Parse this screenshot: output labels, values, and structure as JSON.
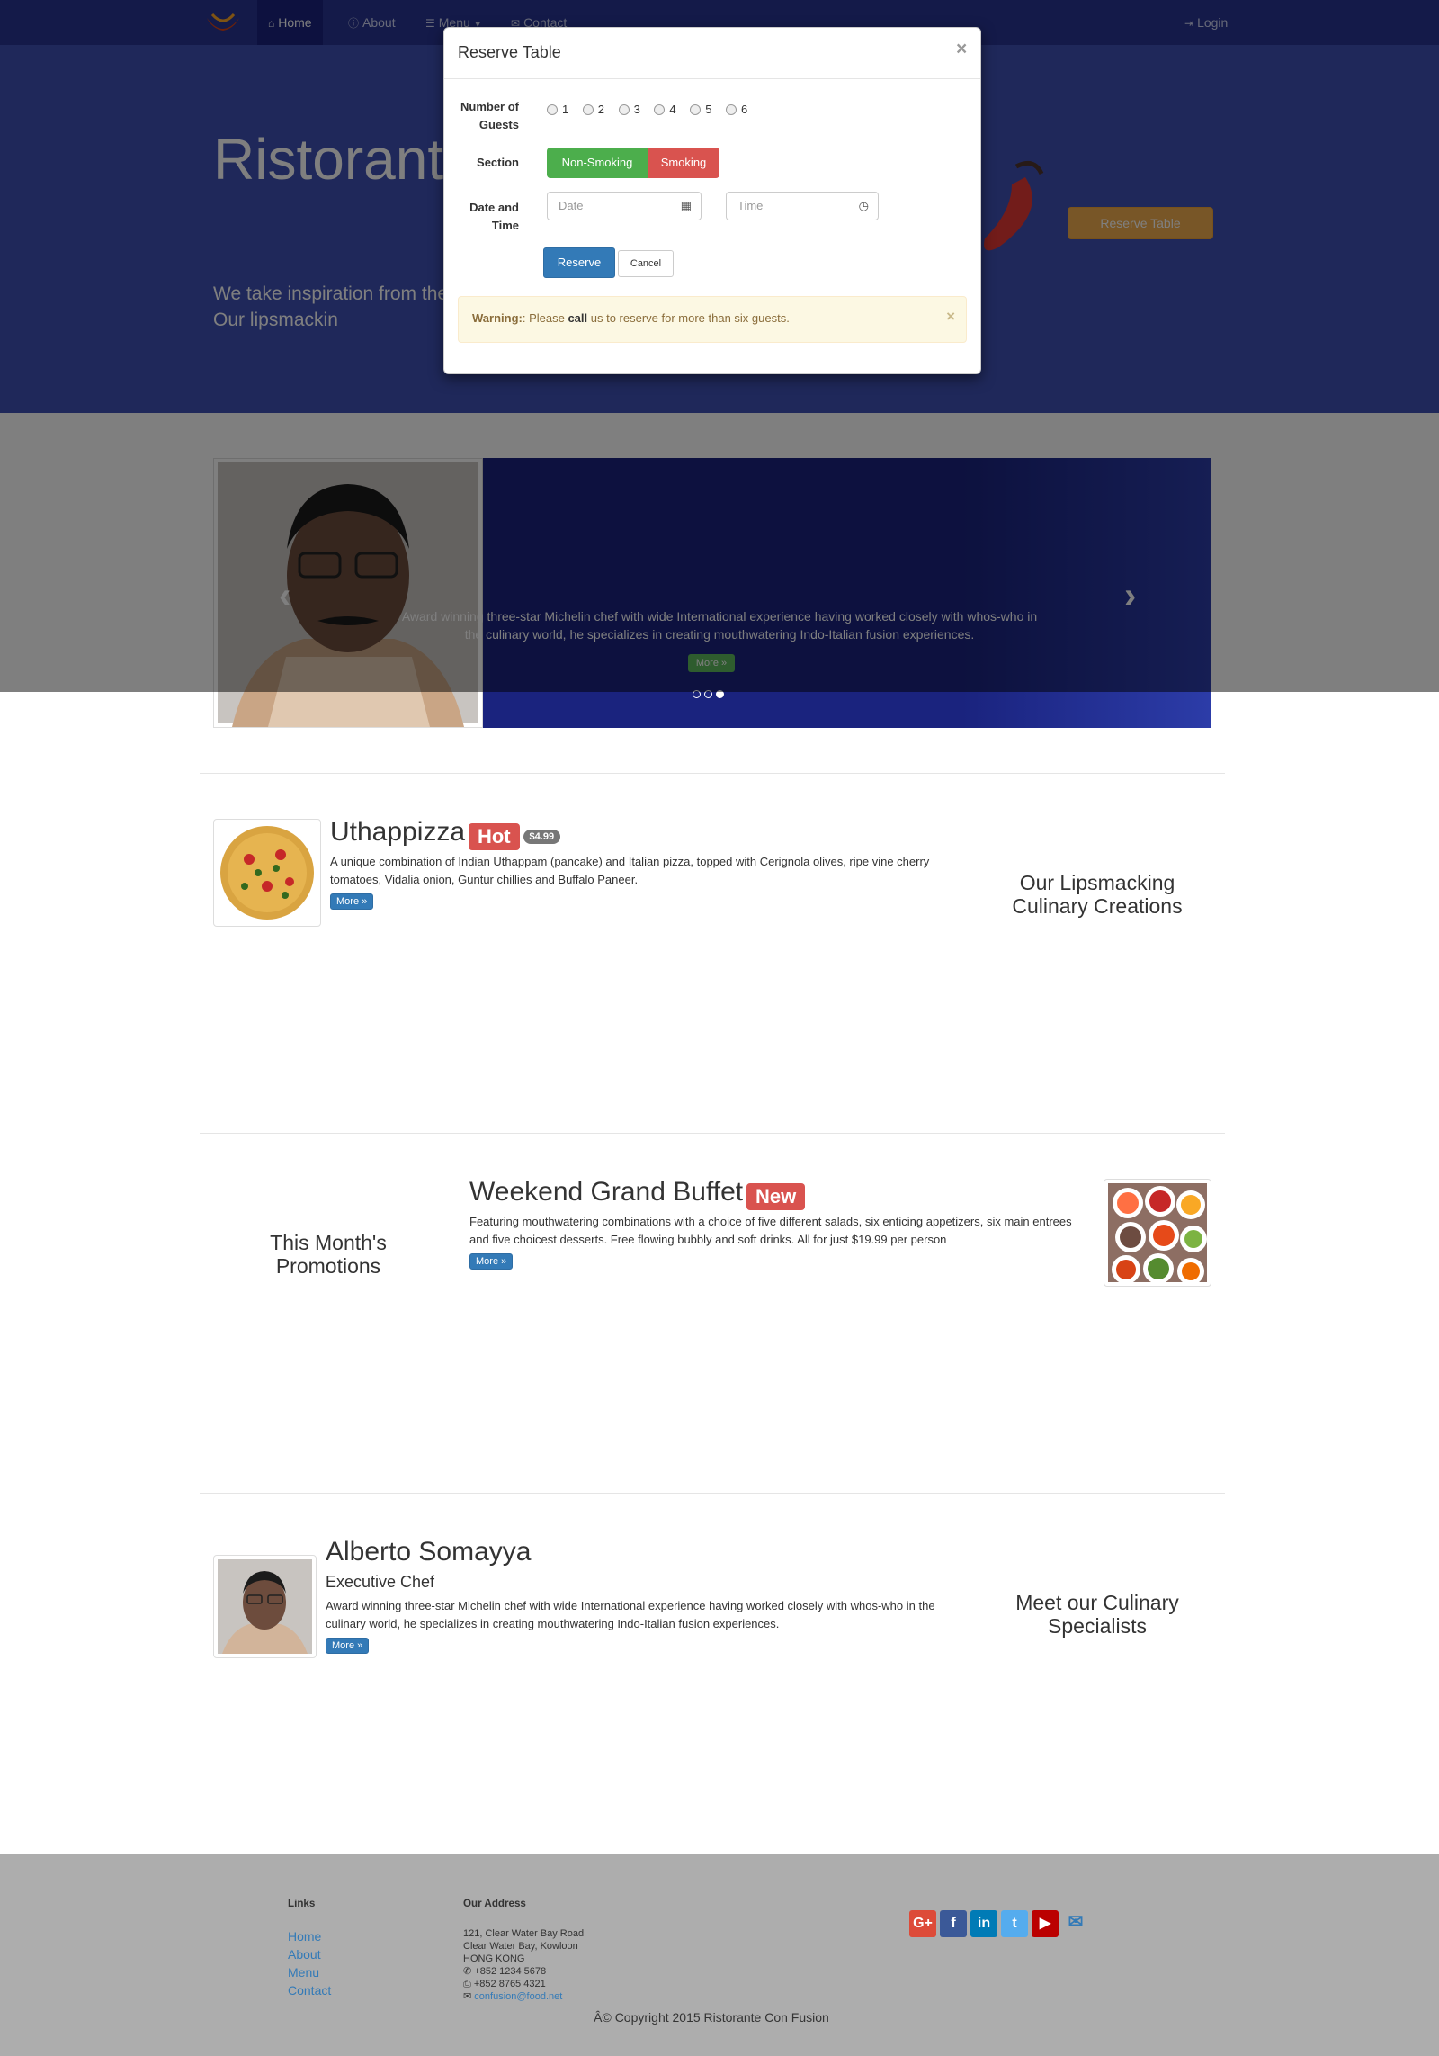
{
  "nav": {
    "items": [
      {
        "label": "Home",
        "icon": "home-icon"
      },
      {
        "label": "About",
        "icon": "info-icon"
      },
      {
        "label": "Menu",
        "icon": "list-icon"
      },
      {
        "label": "Contact",
        "icon": "envelope-icon"
      }
    ],
    "login": "Login"
  },
  "jumbotron": {
    "title": "Ristorante",
    "text": "We take inspiration from the experience. Our lipsmackin",
    "reserve_button": "Reserve Table"
  },
  "carousel": {
    "caption": "Award winning three-star Michelin chef with wide International experience having worked closely with whos-who in the culinary world, he specializes in creating mouthwatering Indo-Italian fusion experiences.",
    "more": "More »",
    "slides": 3,
    "active_slide": 3
  },
  "dish": {
    "name": "Uthappizza",
    "label": "Hot",
    "price": "$4.99",
    "description": "A unique combination of Indian Uthappam (pancake) and Italian pizza, topped with Cerignola olives, ripe vine cherry tomatoes, Vidalia onion, Guntur chillies and Buffalo Paneer.",
    "more": "More »",
    "side_heading": "Our Lipsmacking Culinary Creations"
  },
  "promotion": {
    "name": "Weekend Grand Buffet",
    "label": "New",
    "description": "Featuring mouthwatering combinations with a choice of five different salads, six enticing appetizers, six main entrees and five choicest desserts. Free flowing bubbly and soft drinks. All for just $19.99 per person",
    "more": "More »",
    "side_heading": "This Month's Promotions"
  },
  "leader": {
    "name": "Alberto Somayya",
    "designation": "Executive Chef",
    "description": "Award winning three-star Michelin chef with wide International experience having worked closely with whos-who in the culinary world, he specializes in creating mouthwatering Indo-Italian fusion experiences.",
    "more": "More »",
    "side_heading": "Meet our Culinary Specialists"
  },
  "footer": {
    "links_heading": "Links",
    "links": [
      "Home",
      "About",
      "Menu",
      "Contact"
    ],
    "address_heading": "Our Address",
    "address_lines": [
      "121, Clear Water Bay Road",
      "Clear Water Bay, Kowloon",
      "HONG KONG"
    ],
    "phone": "+852 1234 5678",
    "fax": "+852 8765 4321",
    "email": "confusion@food.net",
    "social": [
      "G+",
      "f",
      "in",
      "t",
      "▶"
    ],
    "copyright": "Â© Copyright 2015 Ristorante Con Fusion"
  },
  "modal": {
    "title": "Reserve Table",
    "close": "×",
    "guests_label": "Number of Guests",
    "guests_options": [
      "1",
      "2",
      "3",
      "4",
      "5",
      "6"
    ],
    "section_label": "Section",
    "section_options": [
      "Non-Smoking",
      "Smoking"
    ],
    "datetime_label": "Date and Time",
    "date_placeholder": "Date",
    "time_placeholder": "Time",
    "reserve_button": "Reserve",
    "cancel_button": "Cancel",
    "warning_strong": "Warning:",
    "warning_text_1": ": Please ",
    "warning_call": "call",
    "warning_text_2": " us to reserve for more than six guests.",
    "warning_close": "×"
  },
  "colors": {
    "navbar": "#283593",
    "jumbotron": "#3f51b5",
    "carousel": "#1a237e",
    "success": "#4cae4c",
    "danger": "#d9534f",
    "primary": "#337ab7",
    "warning": "#f0ad4e"
  }
}
